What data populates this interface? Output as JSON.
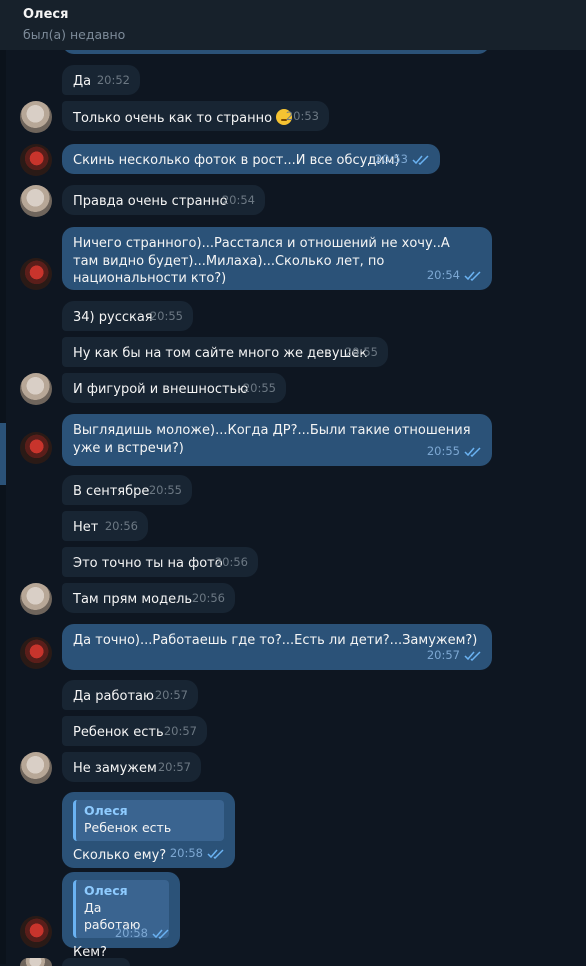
{
  "header": {
    "contact_name": "Олеся",
    "status": "был(а) недавно"
  },
  "messages": [
    {
      "text": "Да",
      "time": "20:52"
    },
    {
      "text": "Только очень как то странно",
      "time": "20:53"
    },
    {
      "text": "Скинь несколько фоток в рост...И все обсудим)",
      "time": "20:53"
    },
    {
      "text": "Правда очень странно",
      "time": "20:54"
    },
    {
      "text": "Ничего странного)...Расстался и отношений не хочу..А там видно будет)...Милаха)...Сколько лет, по национальности кто?)",
      "time": "20:54"
    },
    {
      "text": "34) русская",
      "time": "20:55"
    },
    {
      "text": "Ну как бы на том сайте много же девушек",
      "time": "20:55"
    },
    {
      "text": "И фигурой и внешностью",
      "time": "20:55"
    },
    {
      "text": "Выглядишь моложе)...Когда ДР?...Были такие отношения уже и встречи?)",
      "time": "20:55"
    },
    {
      "text": "В сентябре",
      "time": "20:55"
    },
    {
      "text": "Нет",
      "time": "20:56"
    },
    {
      "text": "Это точно ты на фото",
      "time": "20:56"
    },
    {
      "text": "Там прям модель",
      "time": "20:56"
    },
    {
      "text": "Да точно)...Работаешь где то?...Есть ли дети?...Замужем?)",
      "time": "20:57"
    },
    {
      "text": "Да работаю",
      "time": "20:57"
    },
    {
      "text": "Ребенок есть",
      "time": "20:57"
    },
    {
      "text": "Не замужем",
      "time": "20:57"
    },
    {
      "text": "Сколько ему?",
      "time": "20:58",
      "reply_name": "Олеся",
      "reply_text": "Ребенок есть"
    },
    {
      "text": "Кем?",
      "time": "20:58",
      "reply_name": "Олеся",
      "reply_text": "Да работаю"
    }
  ],
  "colors": {
    "background": "#0e1621",
    "incoming": "#182533",
    "outgoing": "#2b5278",
    "read_check": "#6ab2f2"
  },
  "icons": {
    "read": "double-check-icon",
    "emoji": "thinking-face-icon"
  }
}
